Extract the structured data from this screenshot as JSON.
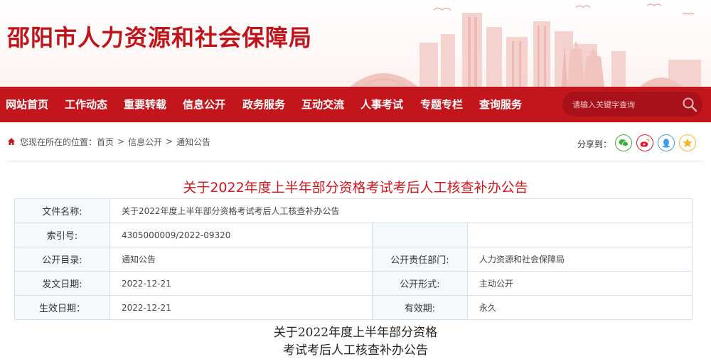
{
  "header": {
    "site_title": "邵阳市人力资源和社会保障局"
  },
  "nav": {
    "items": [
      {
        "label": "网站首页"
      },
      {
        "label": "工作动态"
      },
      {
        "label": "重要转载"
      },
      {
        "label": "信息公开"
      },
      {
        "label": "政务服务"
      },
      {
        "label": "互动交流"
      },
      {
        "label": "人事考试"
      },
      {
        "label": "专题专栏"
      },
      {
        "label": "查询服务"
      }
    ],
    "search": {
      "placeholder": "请输入关键字查询",
      "icon": "search-icon"
    }
  },
  "breadcrumb": {
    "prefix": "您现在所在的位置：",
    "items": [
      "首页",
      "信息公开",
      "通知公告"
    ],
    "separator": ">",
    "icon": "home-icon"
  },
  "share": {
    "label": "分享到：",
    "buttons": [
      {
        "name": "wechat",
        "color": "#3eb135"
      },
      {
        "name": "weibo",
        "color": "#e6162d"
      },
      {
        "name": "qq",
        "color": "#3e9fe6"
      },
      {
        "name": "qzone",
        "color": "#f4b82a"
      }
    ]
  },
  "article": {
    "title": "关于2022年度上半年部分资格考试考后人工核查补办公告",
    "body_title_line1": "关于2022年度上半年部分资格",
    "body_title_line2": "考试考后人工核查补办公告"
  },
  "info": {
    "file_name_label": "文件名称:",
    "file_name_value": "关于2022年度上半年部分资格考试考后人工核查补办公告",
    "index_label": "索引号:",
    "index_value": "4305000009/2022-09320",
    "catalog_label": "公开目录:",
    "catalog_value": "通知公告",
    "dept_label": "公开责任部门:",
    "dept_value": "人力资源和社会保障局",
    "issue_date_label": "发文日期:",
    "issue_date_value": "2022-12-21",
    "form_label": "公开形式:",
    "form_value": "主动公开",
    "effective_label": "生效日期：",
    "effective_value": "2022-12-21",
    "validity_label": "有效期:",
    "validity_value": "永久"
  },
  "colors": {
    "brand_red": "#c3161c",
    "title_red": "#d0171e",
    "table_border": "#cfe1ef",
    "label_bg": "#f5f9fc"
  }
}
